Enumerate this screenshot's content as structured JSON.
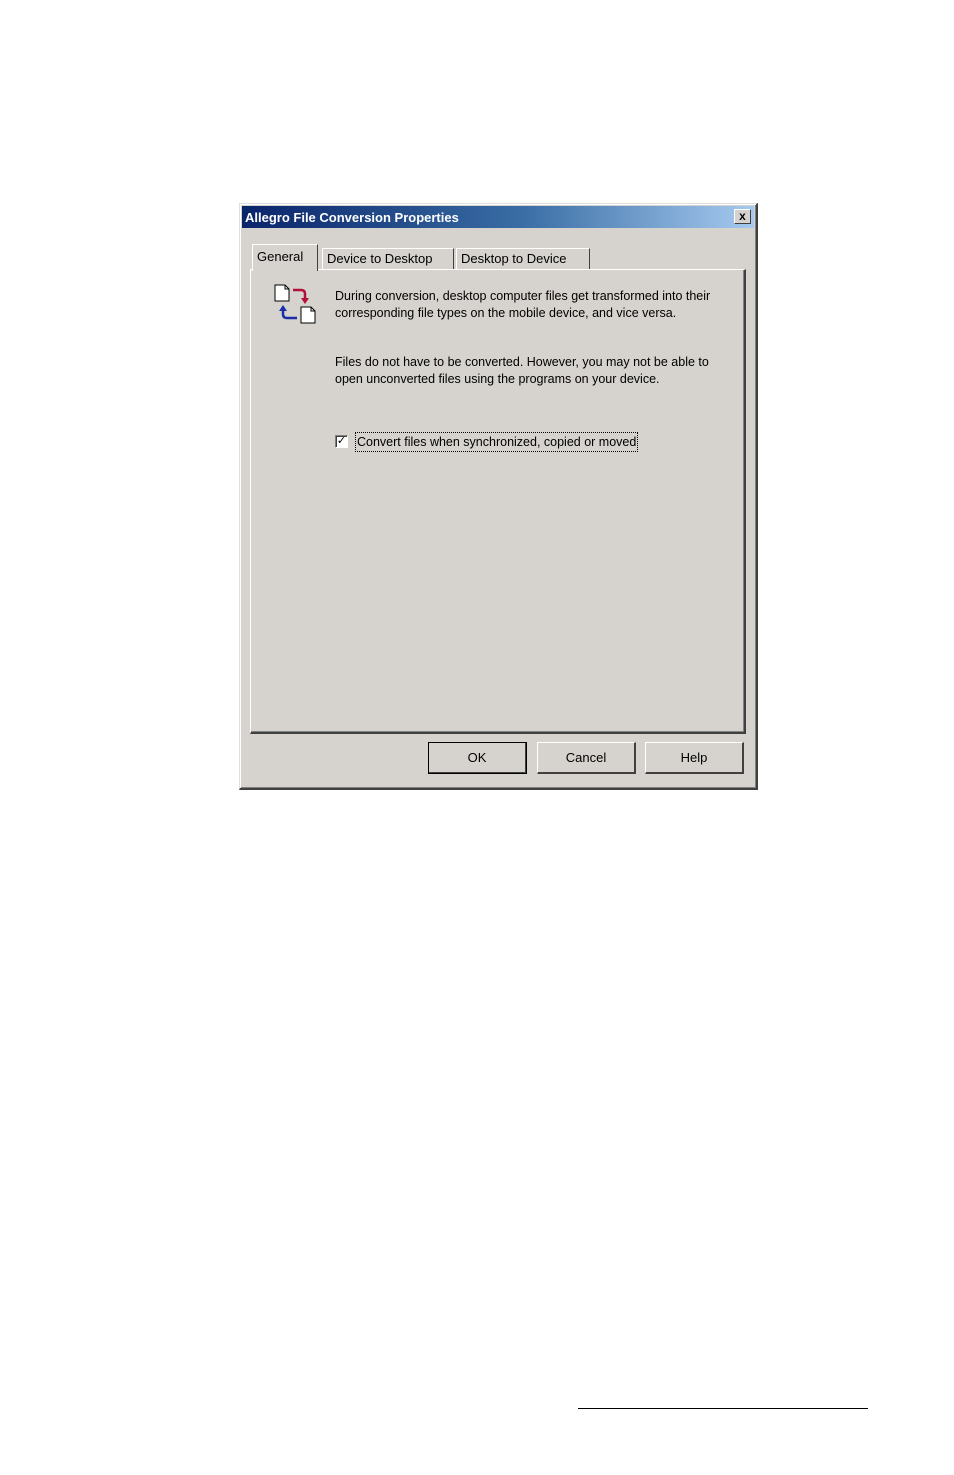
{
  "window": {
    "title": "Allegro File Conversion Properties",
    "close_glyph": "x"
  },
  "tabs": [
    {
      "label": "General",
      "active": true
    },
    {
      "label": "Device to Desktop",
      "active": false
    },
    {
      "label": "Desktop to Device",
      "active": false
    }
  ],
  "general": {
    "icon": "file-conversion-icon",
    "paragraph1": "During conversion, desktop computer files get transformed into their corresponding file types on the mobile device, and vice versa.",
    "paragraph2": "Files do not have to be converted. However, you may not be able to open unconverted files using the programs on your device.",
    "checkbox": {
      "label": "Convert files when synchronized, copied or moved",
      "checked": true,
      "check_glyph": "✓"
    }
  },
  "buttons": {
    "ok": "OK",
    "cancel": "Cancel",
    "help": "Help"
  }
}
